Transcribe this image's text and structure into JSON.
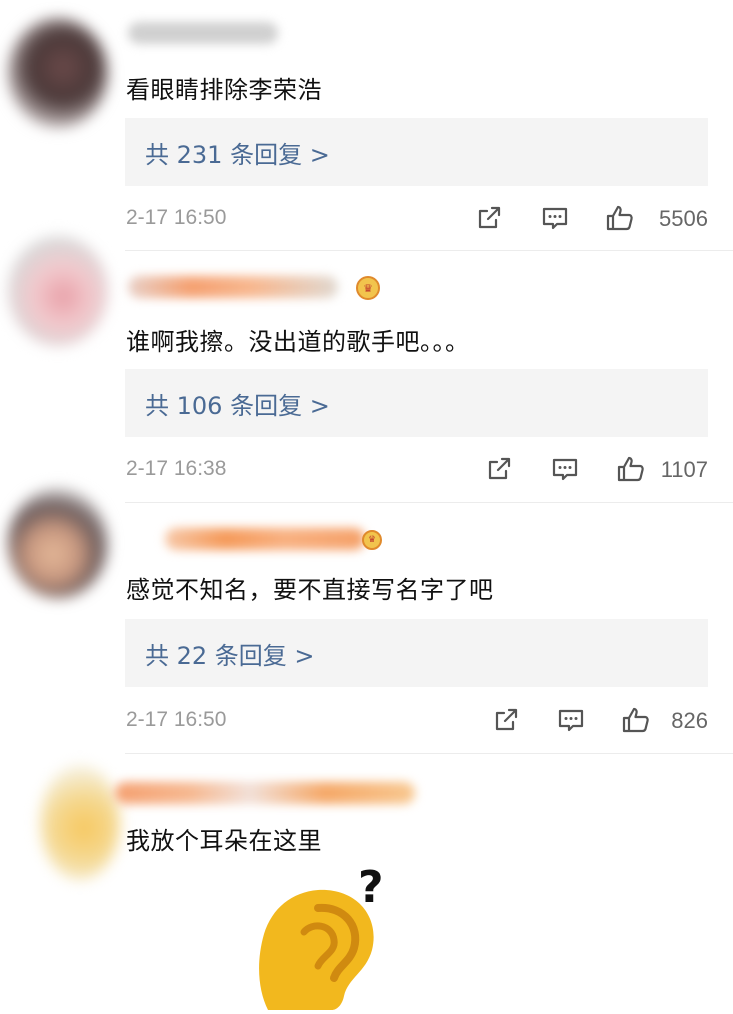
{
  "comments": [
    {
      "text": "看眼睛排除李荣浩",
      "replies": "共 231 条回复 >",
      "time": "2-17 16:50",
      "likes": "5506"
    },
    {
      "text": "谁啊我擦。没出道的歌手吧。。。",
      "replies": "共 106 条回复 >",
      "time": "2-17 16:38",
      "likes": "1107"
    },
    {
      "text": "感觉不知名，要不直接写名字了吧",
      "replies": "共 22 条回复 >",
      "time": "2-17 16:50",
      "likes": "826"
    },
    {
      "text": "我放个耳朵在这里"
    }
  ],
  "emoji": {
    "question_mark": "?",
    "ear_color": "#f2b81e"
  },
  "colors": {
    "reply_link": "#4a6a94",
    "meta_gray": "#9a9a9a",
    "reply_bg": "#f4f4f4"
  }
}
